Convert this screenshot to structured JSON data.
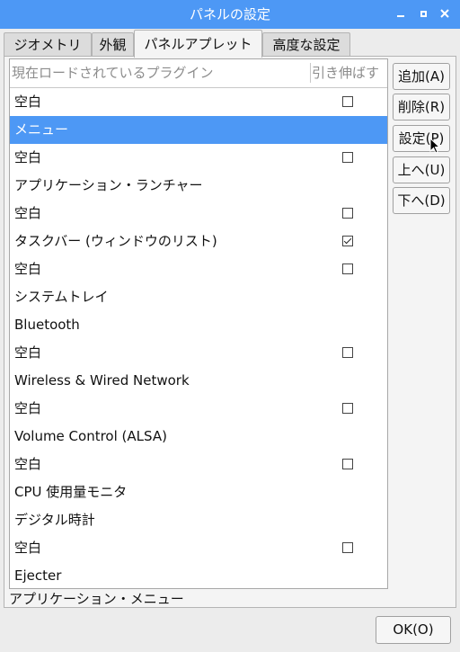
{
  "window": {
    "title": "パネルの設定"
  },
  "tabs": [
    {
      "label": "ジオメトリ"
    },
    {
      "label": "外観"
    },
    {
      "label": "パネルアプレット"
    },
    {
      "label": "高度な設定"
    }
  ],
  "list": {
    "col_plugin": "現在ロードされているプラグイン",
    "col_stretch": "引き伸ばす",
    "rows": [
      {
        "label": "空白",
        "check": "off"
      },
      {
        "label": "メニュー",
        "check": "none",
        "selected": true
      },
      {
        "label": "空白",
        "check": "off"
      },
      {
        "label": "アプリケーション・ランチャー",
        "check": "none"
      },
      {
        "label": "空白",
        "check": "off"
      },
      {
        "label": "タスクバー (ウィンドウのリスト)",
        "check": "on"
      },
      {
        "label": "空白",
        "check": "off"
      },
      {
        "label": "システムトレイ",
        "check": "none"
      },
      {
        "label": "Bluetooth",
        "check": "none"
      },
      {
        "label": "空白",
        "check": "off"
      },
      {
        "label": "Wireless & Wired Network",
        "check": "none"
      },
      {
        "label": "空白",
        "check": "off"
      },
      {
        "label": "Volume Control (ALSA)",
        "check": "none"
      },
      {
        "label": "空白",
        "check": "off"
      },
      {
        "label": "CPU 使用量モニタ",
        "check": "none"
      },
      {
        "label": "デジタル時計",
        "check": "none"
      },
      {
        "label": "空白",
        "check": "off"
      },
      {
        "label": "Ejecter",
        "check": "none"
      }
    ]
  },
  "buttons": {
    "add": "追加(A)",
    "remove": "削除(R)",
    "settings": "設定(P)",
    "up": "上へ(U)",
    "down": "下へ(D)",
    "ok": "OK(O)"
  },
  "status": {
    "description": "アプリケーション・メニュー"
  },
  "colors": {
    "titlebar": "#4d98f5",
    "selection": "#4d98f5"
  }
}
